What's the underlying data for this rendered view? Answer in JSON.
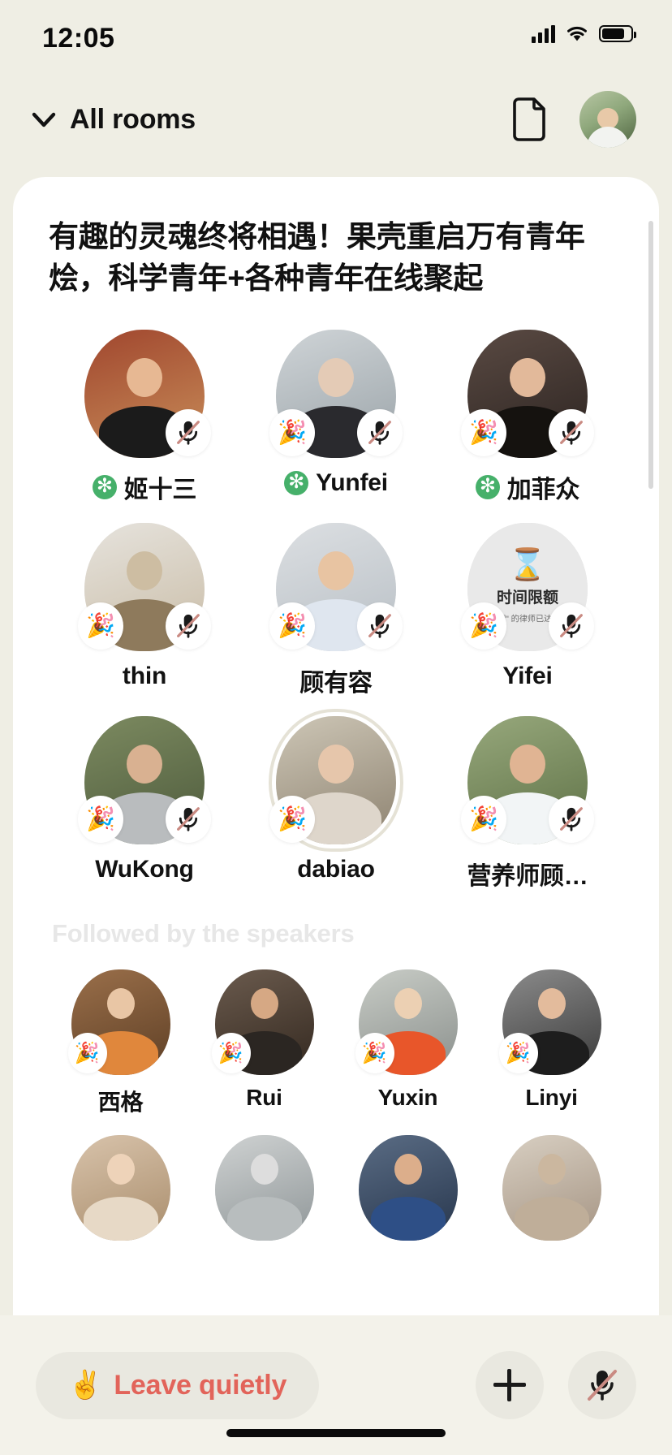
{
  "status_bar": {
    "time": "12:05",
    "signal_icon": "cellular-bars-icon",
    "wifi_icon": "wifi-icon",
    "battery_icon": "battery-icon"
  },
  "nav": {
    "chevron_icon": "chevron-down-icon",
    "title": "All rooms",
    "doc_icon": "document-icon",
    "avatar_icon": "user-avatar"
  },
  "room": {
    "title": "有趣的灵魂终将相遇！果壳重启万有青年烩，科学青年+各种青年在线聚起",
    "speakers": [
      {
        "name": "姬十三",
        "has_star": true,
        "mic_muted": true,
        "party": false,
        "ring": false,
        "photo": "photo-temple-man",
        "c1": "#a0462e",
        "c2": "#c98f5a",
        "skin": "#e7b893",
        "shirt": "#1b1b1b"
      },
      {
        "name": "Yunfei",
        "has_star": true,
        "mic_muted": true,
        "party": true,
        "ring": false,
        "photo": "photo-hoodie-person",
        "c1": "#cfd4d7",
        "c2": "#9aa3a8",
        "skin": "#e4cbb6",
        "shirt": "#2a2a2e"
      },
      {
        "name": "加菲众",
        "has_star": true,
        "mic_muted": true,
        "party": true,
        "ring": false,
        "photo": "photo-suit-man",
        "c1": "#5a4a43",
        "c2": "#2b2320",
        "skin": "#e2b99a",
        "shirt": "#15120f"
      },
      {
        "name": "thin",
        "has_star": false,
        "mic_muted": true,
        "party": true,
        "ring": false,
        "photo": "photo-camel",
        "c1": "#e6e3dd",
        "c2": "#c9bca6",
        "skin": "#cdbda2",
        "shirt": "#8e7a5c"
      },
      {
        "name": "顾有容",
        "has_star": false,
        "mic_muted": true,
        "party": true,
        "ring": false,
        "photo": "photo-glasses-man",
        "c1": "#dcdfe2",
        "c2": "#b8bfc5",
        "skin": "#e8c4a2",
        "shirt": "#dfe6ef"
      },
      {
        "name": "Yifei",
        "has_star": false,
        "mic_muted": true,
        "party": true,
        "ring": false,
        "photo": "time-limit-placeholder",
        "time_limit": {
          "icon": "hourglass-icon",
          "line1": "时间限额",
          "line2": "\"畅聊\" 的律师已达限额"
        }
      },
      {
        "name": "WuKong",
        "has_star": false,
        "mic_muted": true,
        "party": true,
        "ring": false,
        "photo": "photo-cap-man",
        "c1": "#7c8a60",
        "c2": "#4d5a3c",
        "skin": "#d9b191",
        "shirt": "#b9bcbe"
      },
      {
        "name": "dabiao",
        "has_star": false,
        "mic_muted": false,
        "party": true,
        "ring": true,
        "photo": "photo-woman-wall",
        "c1": "#cdc6b6",
        "c2": "#8d8270",
        "skin": "#e6c6ab",
        "shirt": "#ded6cb"
      },
      {
        "name": "营养师顾…",
        "has_star": false,
        "mic_muted": true,
        "party": true,
        "ring": false,
        "photo": "photo-doctor-man",
        "c1": "#97a87c",
        "c2": "#5d7045",
        "skin": "#e0b493",
        "shirt": "#f2f5f6"
      }
    ],
    "followed_section_label": "Followed by the speakers",
    "followers": [
      {
        "name": "西格",
        "party": true,
        "photo": "photo-helmet-woman",
        "c1": "#9a6f4a",
        "c2": "#5e3f25",
        "skin": "#e9c6a5",
        "shirt": "#e0873c"
      },
      {
        "name": "Rui",
        "party": true,
        "photo": "photo-closeup-man",
        "c1": "#6b5b4e",
        "c2": "#33281f",
        "skin": "#d6a884",
        "shirt": "#2b2622"
      },
      {
        "name": "Yuxin",
        "party": true,
        "photo": "photo-hat-woman",
        "c1": "#c8ccc6",
        "c2": "#8a8f8c",
        "skin": "#ecd0b3",
        "shirt": "#e8562a"
      },
      {
        "name": "Linyi",
        "party": true,
        "photo": "photo-stripes-woman",
        "c1": "#8b8b8b",
        "c2": "#3a3a3a",
        "skin": "#e3bb9c",
        "shirt": "#1d1d1d"
      }
    ],
    "partial_row": [
      {
        "photo": "photo-blonde-woman",
        "c1": "#d8c3ab",
        "c2": "#a98d6c",
        "skin": "#eed3b9",
        "shirt": "#e7d9c6"
      },
      {
        "photo": "photo-mountain",
        "c1": "#cfd2d2",
        "c2": "#8f9698",
        "skin": "#dddddd",
        "shirt": "#b8bdbe"
      },
      {
        "photo": "photo-blue-shirt",
        "c1": "#5a6c84",
        "c2": "#27364d",
        "skin": "#dcae8b",
        "shirt": "#2e4f86"
      },
      {
        "photo": "photo-cat",
        "c1": "#d8cfc2",
        "c2": "#a59483",
        "skin": "#cbb79f",
        "shirt": "#bfae99"
      }
    ]
  },
  "bottom_bar": {
    "leave_emoji": "✌️",
    "leave_label": "Leave quietly",
    "plus_icon": "plus-icon",
    "mic_icon": "microphone-muted-icon"
  },
  "colors": {
    "page_background": "#efeee4",
    "card_background": "#ffffff",
    "leave_text": "#e2645a",
    "star_badge": "#46b06a",
    "section_label": "#e7e7e7"
  }
}
